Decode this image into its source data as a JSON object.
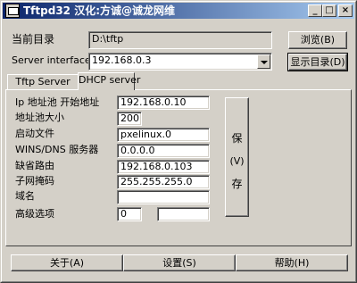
{
  "window": {
    "title": "Tftpd32 汉化:方诚@诚龙网维",
    "controls": {
      "minimize": "_",
      "maximize": "□",
      "close": "×"
    }
  },
  "top": {
    "current_dir_label": "当前目录",
    "current_dir_value": "D:\\tftp",
    "browse_button": "浏览(B)",
    "server_interfaces_label": "Server interfaces",
    "server_interface_value": "192.168.0.3",
    "show_dir_button": "显示目录(D)"
  },
  "tabs": [
    {
      "label": "Tftp Server",
      "active": false
    },
    {
      "label": "DHCP server",
      "active": true
    }
  ],
  "dhcp": {
    "fields": [
      {
        "label": "Ip 地址池 开始地址",
        "value": "192.168.0.10"
      },
      {
        "label": "地址池大小",
        "value": "200"
      },
      {
        "label": "启动文件",
        "value": "pxelinux.0"
      },
      {
        "label": "WINS/DNS 服务器",
        "value": "0.0.0.0"
      },
      {
        "label": "缺省路由",
        "value": "192.168.0.103"
      },
      {
        "label": "子网掩码",
        "value": "255.255.255.0"
      },
      {
        "label": "域名",
        "value": ""
      },
      {
        "label": "高级选项",
        "value": "0",
        "value2": ""
      }
    ],
    "save_button": {
      "line1": "保",
      "line2": "(V)",
      "line3": "存"
    }
  },
  "bottom": {
    "about_button": "关于(A)",
    "settings_button": "设置(S)",
    "help_button": "帮助(H)"
  }
}
